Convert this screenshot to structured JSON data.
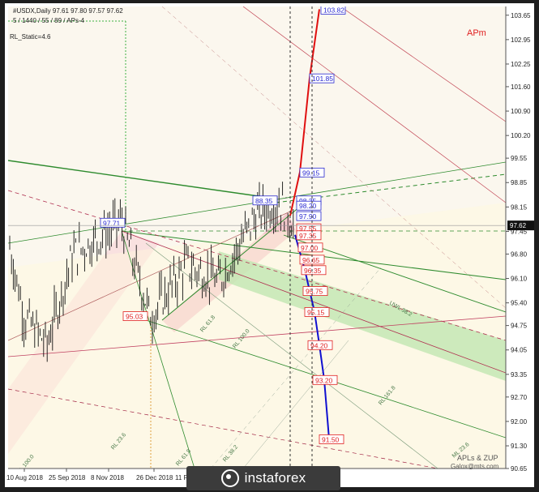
{
  "header": {
    "line1": "#USDX,Daily  97.61 97.80 97.57 97.62",
    "line2": "5 / 1440 / 55 / 89 / APs-4",
    "line3": "RL_Static=4.6"
  },
  "tag": "APm",
  "credits": [
    "APLs & ZUP",
    "Galox@mts.com"
  ],
  "brand": "instaforex",
  "chart_data": {
    "type": "line",
    "title": "",
    "ylim": [
      90.65,
      103.9
    ],
    "y_ticks": [
      "103.65",
      "102.95",
      "102.25",
      "101.60",
      "100.90",
      "100.20",
      "99.55",
      "98.85",
      "98.15",
      "97.45",
      "96.80",
      "96.10",
      "95.40",
      "94.75",
      "94.05",
      "93.35",
      "92.70",
      "92.00",
      "91.30",
      "90.65"
    ],
    "x_ticks": [
      "10 Aug 2018",
      "25 Sep 2018",
      "8 Nov 2018",
      "26 Dec 2018",
      "11 Feb"
    ],
    "last_price": "97.62",
    "price_points": [
      {
        "label": "97.71",
        "value": 97.71,
        "color": "#2a2ad0"
      },
      {
        "label": "95.03",
        "value": 95.03,
        "color": "#e02020"
      },
      {
        "label": "88.35",
        "value": 98.35,
        "color": "#2a2ad0"
      },
      {
        "label": "103.82",
        "value": 103.82,
        "color": "#2a2ad0"
      },
      {
        "label": "101.85",
        "value": 101.85,
        "color": "#2a2ad0"
      },
      {
        "label": "99.15",
        "value": 99.15,
        "color": "#2a2ad0"
      },
      {
        "label": "98.35",
        "value": 98.35,
        "color": "#2a2ad0"
      },
      {
        "label": "98.20",
        "value": 98.2,
        "color": "#2a2ad0"
      },
      {
        "label": "97.90",
        "value": 97.9,
        "color": "#2a2ad0"
      },
      {
        "label": "97.55",
        "value": 97.55,
        "color": "#e02020"
      },
      {
        "label": "97.35",
        "value": 97.35,
        "color": "#e02020"
      },
      {
        "label": "97.00",
        "value": 97.0,
        "color": "#e02020"
      },
      {
        "label": "96.65",
        "value": 96.65,
        "color": "#e02020"
      },
      {
        "label": "96.35",
        "value": 96.35,
        "color": "#e02020"
      },
      {
        "label": "95.75",
        "value": 95.75,
        "color": "#e02020"
      },
      {
        "label": "95.15",
        "value": 95.15,
        "color": "#e02020"
      },
      {
        "label": "94.20",
        "value": 94.2,
        "color": "#e02020"
      },
      {
        "label": "93.20",
        "value": 93.2,
        "color": "#e02020"
      },
      {
        "label": "91.50",
        "value": 91.5,
        "color": "#e02020"
      }
    ],
    "line_labels": [
      "UWL 38.2",
      "RL 61.8",
      "RL 100.0",
      "RL 161.8",
      "RL 23.6",
      "RL 38.2",
      "RL 61.8",
      "RL 100.0",
      "ML 23.6"
    ],
    "up_path": [
      {
        "i": 100,
        "y": 97.9
      },
      {
        "i": 102,
        "y": 99.15
      },
      {
        "i": 104,
        "y": 101.85
      },
      {
        "i": 106,
        "y": 103.82
      }
    ],
    "down_path": [
      {
        "i": 101,
        "y": 97.35
      },
      {
        "i": 103,
        "y": 96.35
      },
      {
        "i": 104,
        "y": 95.75
      },
      {
        "i": 105,
        "y": 95.15
      },
      {
        "i": 106,
        "y": 94.2
      },
      {
        "i": 107,
        "y": 93.2
      },
      {
        "i": 108,
        "y": 91.5
      }
    ],
    "colors": {
      "up": "#e01010",
      "down": "#1010d0",
      "green_band": "#3cb043",
      "pink_band": "#f4a6b4"
    }
  }
}
